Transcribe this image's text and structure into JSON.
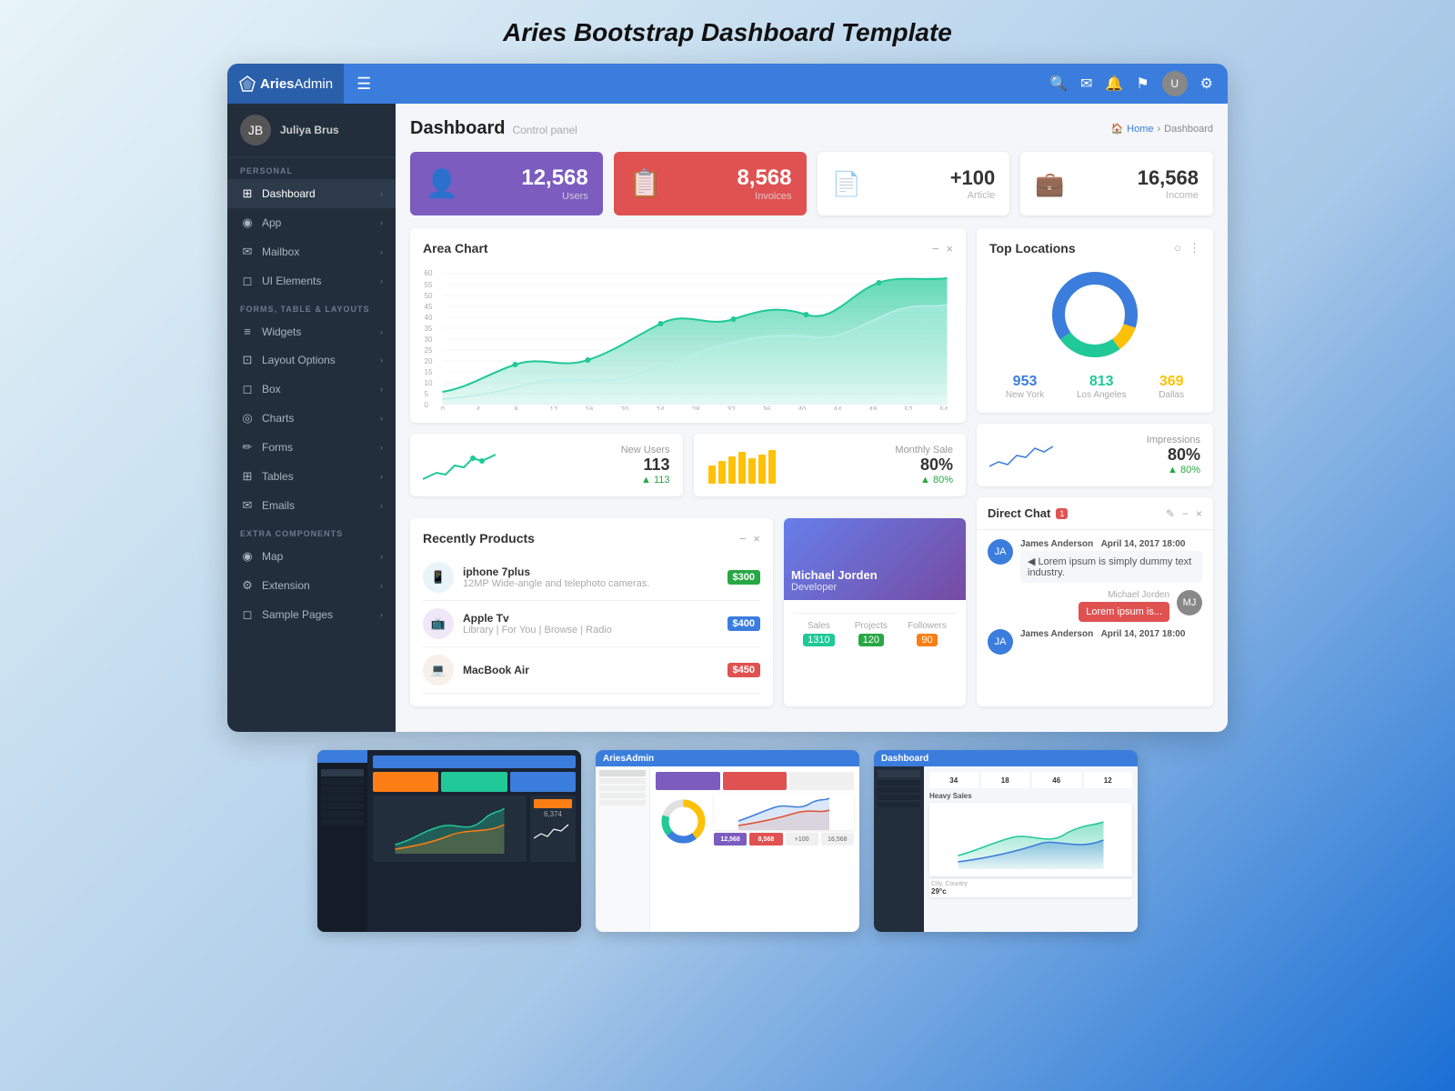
{
  "page": {
    "main_title": "Aries Bootstrap Dashboard Template"
  },
  "navbar": {
    "brand_bold": "Aries",
    "brand_light": "Admin",
    "hamburger_label": "☰",
    "icons": [
      "🔍",
      "✉",
      "🔔",
      "⚑",
      "⚙"
    ],
    "avatar_text": "U"
  },
  "sidebar": {
    "username": "Juliya Brus",
    "sections": [
      {
        "label": "PERSONAL",
        "items": [
          {
            "icon": "⊞",
            "label": "Dashboard",
            "active": true
          },
          {
            "icon": "◉",
            "label": "App"
          },
          {
            "icon": "✉",
            "label": "Mailbox"
          },
          {
            "icon": "◻",
            "label": "UI Elements"
          }
        ]
      },
      {
        "label": "FORMS, TABLE & LAYOUTS",
        "items": [
          {
            "icon": "≡",
            "label": "Widgets"
          },
          {
            "icon": "⊡",
            "label": "Layout Options"
          },
          {
            "icon": "◻",
            "label": "Box"
          },
          {
            "icon": "◎",
            "label": "Charts"
          },
          {
            "icon": "✏",
            "label": "Forms"
          },
          {
            "icon": "⊞",
            "label": "Tables"
          },
          {
            "icon": "✉",
            "label": "Emails"
          }
        ]
      },
      {
        "label": "EXTRA COMPONENTS",
        "items": [
          {
            "icon": "◉",
            "label": "Map"
          },
          {
            "icon": "⚙",
            "label": "Extension"
          },
          {
            "icon": "◻",
            "label": "Sample Pages"
          }
        ]
      }
    ]
  },
  "header": {
    "title": "Dashboard",
    "subtitle": "Control panel",
    "breadcrumb": [
      "Home",
      "Dashboard"
    ]
  },
  "stat_cards": [
    {
      "icon": "👤",
      "value": "12,568",
      "label": "Users",
      "style": "purple"
    },
    {
      "icon": "📋",
      "value": "8,568",
      "label": "Invoices",
      "style": "red"
    },
    {
      "icon": "📄",
      "value": "+100",
      "label": "Article",
      "style": "white"
    },
    {
      "icon": "💼",
      "value": "16,568",
      "label": "Income",
      "style": "white"
    }
  ],
  "area_chart": {
    "title": "Area Chart",
    "y_labels": [
      "60",
      "55",
      "50",
      "45",
      "40",
      "35",
      "30",
      "25",
      "20",
      "15",
      "10",
      "5",
      "0"
    ],
    "x_labels": [
      "0",
      "4",
      "8",
      "12",
      "16",
      "20",
      "24",
      "28",
      "32",
      "36",
      "40",
      "44",
      "48",
      "52",
      "54"
    ]
  },
  "small_stats": [
    {
      "label": "New Users",
      "value": "113",
      "change": "▲ 113",
      "chart_color": "#20c997"
    },
    {
      "label": "Monthly Sale",
      "value": "80%",
      "change": "▲ 80%",
      "chart_color": "#ffc107"
    }
  ],
  "top_locations": {
    "title": "Top Locations",
    "locations": [
      {
        "city": "New York",
        "value": "953",
        "color_class": "loc-blue"
      },
      {
        "city": "Los Angeles",
        "value": "813",
        "color_class": "loc-teal"
      },
      {
        "city": "Dallas",
        "value": "369",
        "color_class": "loc-yellow"
      }
    ]
  },
  "impressions": {
    "label": "Impressions",
    "value": "80%",
    "change": "▲ 80%"
  },
  "recently_products": {
    "title": "Recently Products",
    "items": [
      {
        "name": "iphone 7plus",
        "desc": "12MP Wide-angle and telephoto cameras.",
        "price": "$300",
        "price_style": "price-green"
      },
      {
        "name": "Apple Tv",
        "desc": "Library | For You | Browse | Radio",
        "price": "$400",
        "price_style": "price-blue"
      },
      {
        "name": "MacBook Air",
        "desc": "",
        "price": "$450",
        "price_style": "price-red"
      }
    ]
  },
  "profile_card": {
    "name": "Michael Jorden",
    "role": "Developer",
    "stats": [
      {
        "label": "Sales",
        "value": "1310",
        "badge_style": "badge-teal"
      },
      {
        "label": "Projects",
        "value": "120",
        "badge_style": "badge-green"
      },
      {
        "label": "Followers",
        "value": "90",
        "badge_style": "badge-orange"
      }
    ]
  },
  "direct_chat": {
    "title": "Direct Chat",
    "badge": "1",
    "messages": [
      {
        "sender": "James Anderson",
        "time": "April 14, 2017 18:00",
        "text": "◀ Lorem ipsum is simply dummy text industry.",
        "side": "left",
        "avatar_color": "#3b7ddd"
      },
      {
        "sender": "Michael Jorden",
        "time": "",
        "text": "Lorem ipsum is...",
        "side": "right",
        "avatar_color": "#e05252"
      },
      {
        "sender": "James Anderson",
        "time": "April 14, 2017 18:00",
        "text": "",
        "side": "left",
        "avatar_color": "#3b7ddd"
      }
    ]
  },
  "thumbnails": [
    {
      "id": "thumb1",
      "theme": "dark"
    },
    {
      "id": "thumb2",
      "theme": "light"
    },
    {
      "id": "thumb3",
      "theme": "mixed"
    }
  ]
}
